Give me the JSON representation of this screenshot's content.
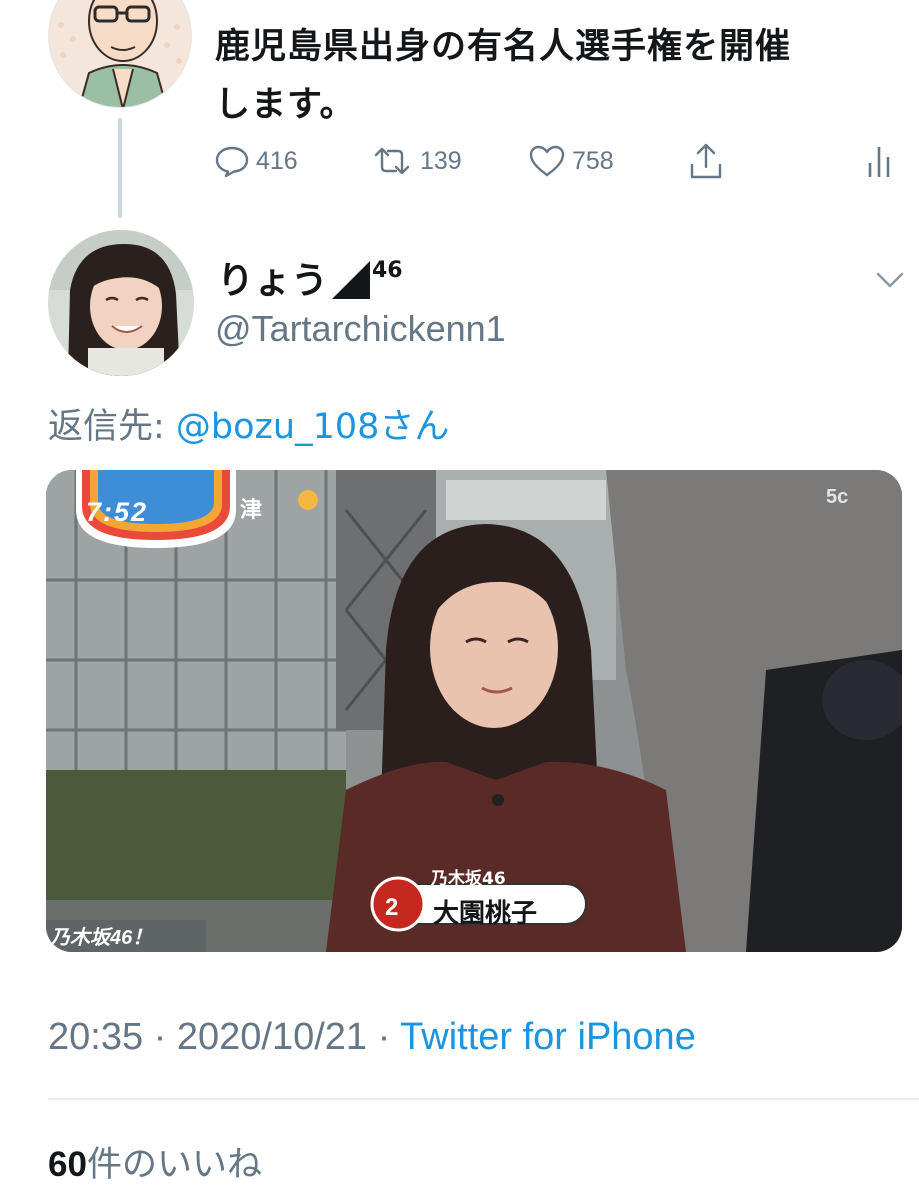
{
  "parent_tweet": {
    "text_line1": "鹿児島県出身の有名人選手権を開催",
    "text_line2": "します。",
    "actions": {
      "reply_count": "416",
      "retweet_count": "139",
      "like_count": "758"
    }
  },
  "tweet": {
    "display_name": "りょう",
    "display_name_suffix": "46",
    "handle": "@Tartarchickenn1",
    "reply_to_label": "返信先: ",
    "reply_to_mention": "@bozu_108さん",
    "media": {
      "clock": "7:52",
      "location": "津",
      "group_caption": "乃木坂46",
      "rank_number": "2",
      "name_caption": "大園桃子",
      "ticker": "乃木坂46！",
      "channel_logo": "5c"
    },
    "timestamp_time": "20:35 · 2020/10/21 · ",
    "timestamp_client": "Twitter for iPhone",
    "likes_count": "60",
    "likes_label": "件のいいね"
  },
  "icons": {
    "reply": "reply-icon",
    "retweet": "retweet-icon",
    "like": "heart-icon",
    "share": "share-icon",
    "analytics": "analytics-icon",
    "more": "chevron-down-icon"
  },
  "colors": {
    "text_primary": "#14171a",
    "text_secondary": "#657786",
    "link": "#1b95e0",
    "divider": "#e6ecf0"
  }
}
